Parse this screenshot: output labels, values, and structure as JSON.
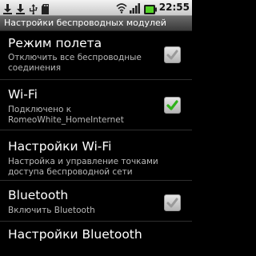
{
  "status_bar": {
    "time": "22:55",
    "icons": [
      "download-icon",
      "download-icon",
      "usb-icon",
      "sd-card-icon",
      "wifi-signal-icon",
      "cell-signal-icon",
      "battery-icon"
    ]
  },
  "title_bar": {
    "title": "Настройки беспроводных модулей"
  },
  "settings": [
    {
      "title": "Режим полета",
      "summary_lines": [
        "Отключить все беспроводные",
        "соединения"
      ],
      "checked": false
    },
    {
      "title": "Wi-Fi",
      "summary_lines": [
        "Подключено к",
        "RomeoWhite_HomeInternet"
      ],
      "checked": true
    },
    {
      "title": "Настройки Wi-Fi",
      "summary_lines": [
        "Настройка и управление точками",
        "доступа беспроводной сети"
      ]
    },
    {
      "title": "Bluetooth",
      "summary_lines": [
        "Включить Bluetooth"
      ],
      "checked": false
    },
    {
      "title": "Настройки Bluetooth",
      "summary_lines": []
    }
  ],
  "colors": {
    "check_green": "#2fb21a",
    "check_grey": "#9a9a9a",
    "summary_text": "#b8b8b8"
  }
}
